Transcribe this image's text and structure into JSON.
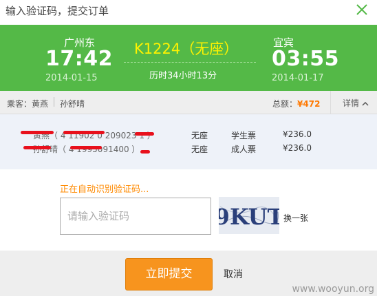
{
  "dialog": {
    "title": "输入验证码，提交订单"
  },
  "train": {
    "from_station": "广州东",
    "depart_time": "17:42",
    "depart_date": "2014-01-15",
    "train_no": "K1224（无座）",
    "duration": "历时34小时13分",
    "to_station": "宜宾",
    "arrive_time": "03:55",
    "arrive_date": "2014-01-17"
  },
  "passengers_bar": {
    "label": "乘客：黄燕",
    "passenger2": "孙舒晴",
    "total_label": "总额：",
    "total_value": "¥472",
    "detail": "详情"
  },
  "tickets": [
    {
      "name": "黄燕（ 4 11902 0 209023 1 ）",
      "seat": "无座",
      "type": "学生票",
      "price": "¥236.0"
    },
    {
      "name": "孙舒晴（ 4 1995091400 ）",
      "seat": "无座",
      "type": "成人票",
      "price": "¥236.0"
    }
  ],
  "captcha": {
    "status": "正在自动识别验证码...",
    "placeholder": "请输入验证码",
    "image_text": "9KUT",
    "refresh": "换一张"
  },
  "actions": {
    "submit": "立即提交",
    "cancel": "取消"
  },
  "watermark": "www.wooyun.org",
  "colors": {
    "banner": "#54b947",
    "train_no": "#fff200",
    "accent": "#ff7800",
    "submit": "#f7941e"
  }
}
